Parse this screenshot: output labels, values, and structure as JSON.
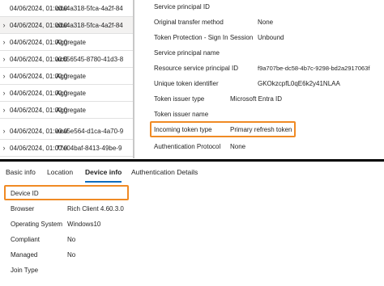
{
  "sign_ins": [
    {
      "date": "04/06/2024, 01:00:0",
      "value": "cda4a318-5fca-4a2f-84",
      "chevron": false,
      "selected": false
    },
    {
      "date": "04/06/2024, 01:00:0",
      "value": "cda4a318-5fca-4a2f-84",
      "chevron": true,
      "selected": true
    },
    {
      "date": "04/06/2024, 01:00:0",
      "value": "Aggregate",
      "chevron": true,
      "selected": false
    },
    {
      "date": "04/06/2024, 01:00:0",
      "value": "ac656545-8780-41d3-8",
      "chevron": true,
      "selected": false
    },
    {
      "date": "04/06/2024, 01:00:0",
      "value": "Aggregate",
      "chevron": true,
      "selected": false
    },
    {
      "date": "04/06/2024, 01:00:0",
      "value": "Aggregate",
      "chevron": true,
      "selected": false
    },
    {
      "date": "04/06/2024, 01:00:0",
      "value": "Aggregate",
      "chevron": true,
      "selected": false
    },
    {
      "date": "04/06/2024, 01:00:0",
      "value": "eea5e564-d1ca-4a70-9",
      "chevron": true,
      "selected": false
    },
    {
      "date": "04/06/2024, 01:00:0",
      "value": "77e04baf-8413-49be-9",
      "chevron": true,
      "selected": false
    }
  ],
  "details": {
    "service_principal_id": {
      "label": "Service principal ID",
      "value": ""
    },
    "original_transfer_method": {
      "label": "Original transfer method",
      "value": "None"
    },
    "token_protection": {
      "label": "Token Protection - Sign In Session",
      "value": "Unbound"
    },
    "service_principal_name": {
      "label": "Service principal name",
      "value": ""
    },
    "resource_service_principal_id": {
      "label": "Resource service principal ID",
      "value": "f9a707be-dc58-4b7c-9298-bd2a2917063f"
    },
    "unique_token_identifier": {
      "label": "Unique token identifier",
      "value": "GKOkzcpfL0qE6k2y41NLAA"
    },
    "token_issuer_type": {
      "label": "Token issuer type",
      "value": "Microsoft Entra ID"
    },
    "token_issuer_name": {
      "label": "Token issuer name",
      "value": ""
    },
    "incoming_token_type": {
      "label": "Incoming token type",
      "value": "Primary refresh token"
    },
    "authentication_protocol": {
      "label": "Authentication Protocol",
      "value": "None"
    }
  },
  "tabs": {
    "basic_info": "Basic info",
    "location": "Location",
    "device_info": "Device info",
    "authentication_details": "Authentication Details"
  },
  "device_info": {
    "device_id": {
      "label": "Device ID",
      "value": ""
    },
    "browser": {
      "label": "Browser",
      "value": "Rich Client 4.60.3.0"
    },
    "operating_system": {
      "label": "Operating System",
      "value": "Windows10"
    },
    "compliant": {
      "label": "Compliant",
      "value": "No"
    },
    "managed": {
      "label": "Managed",
      "value": "No"
    },
    "join_type": {
      "label": "Join Type",
      "value": ""
    }
  },
  "colors": {
    "highlight": "#f08a24",
    "active_tab": "#0f6cbd"
  },
  "icons": {
    "row_chevron": "chevron-right-icon"
  }
}
